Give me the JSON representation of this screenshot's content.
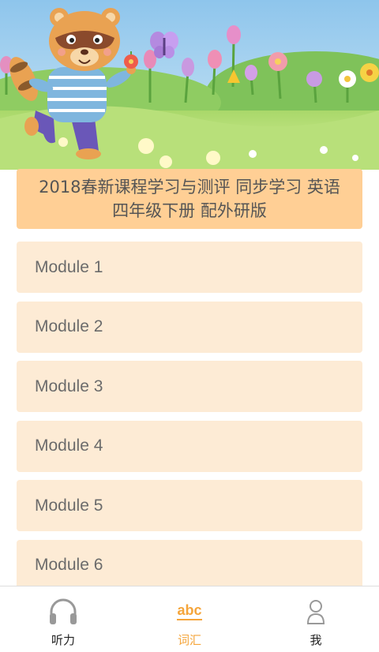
{
  "book": {
    "title": "2018春新课程学习与测评 同步学习 英语 四年级下册 配外研版"
  },
  "modules": [
    {
      "label": "Module 1"
    },
    {
      "label": "Module 2"
    },
    {
      "label": "Module 3"
    },
    {
      "label": "Module 4"
    },
    {
      "label": "Module 5"
    },
    {
      "label": "Module 6"
    }
  ],
  "tabbar": {
    "active_color": "#f5a53b",
    "tabs": [
      {
        "label": "听力",
        "icon": "headphones-icon"
      },
      {
        "label": "词汇",
        "icon": "abc-icon",
        "icon_text": "abc",
        "active": true
      },
      {
        "label": "我",
        "icon": "person-icon"
      }
    ]
  }
}
